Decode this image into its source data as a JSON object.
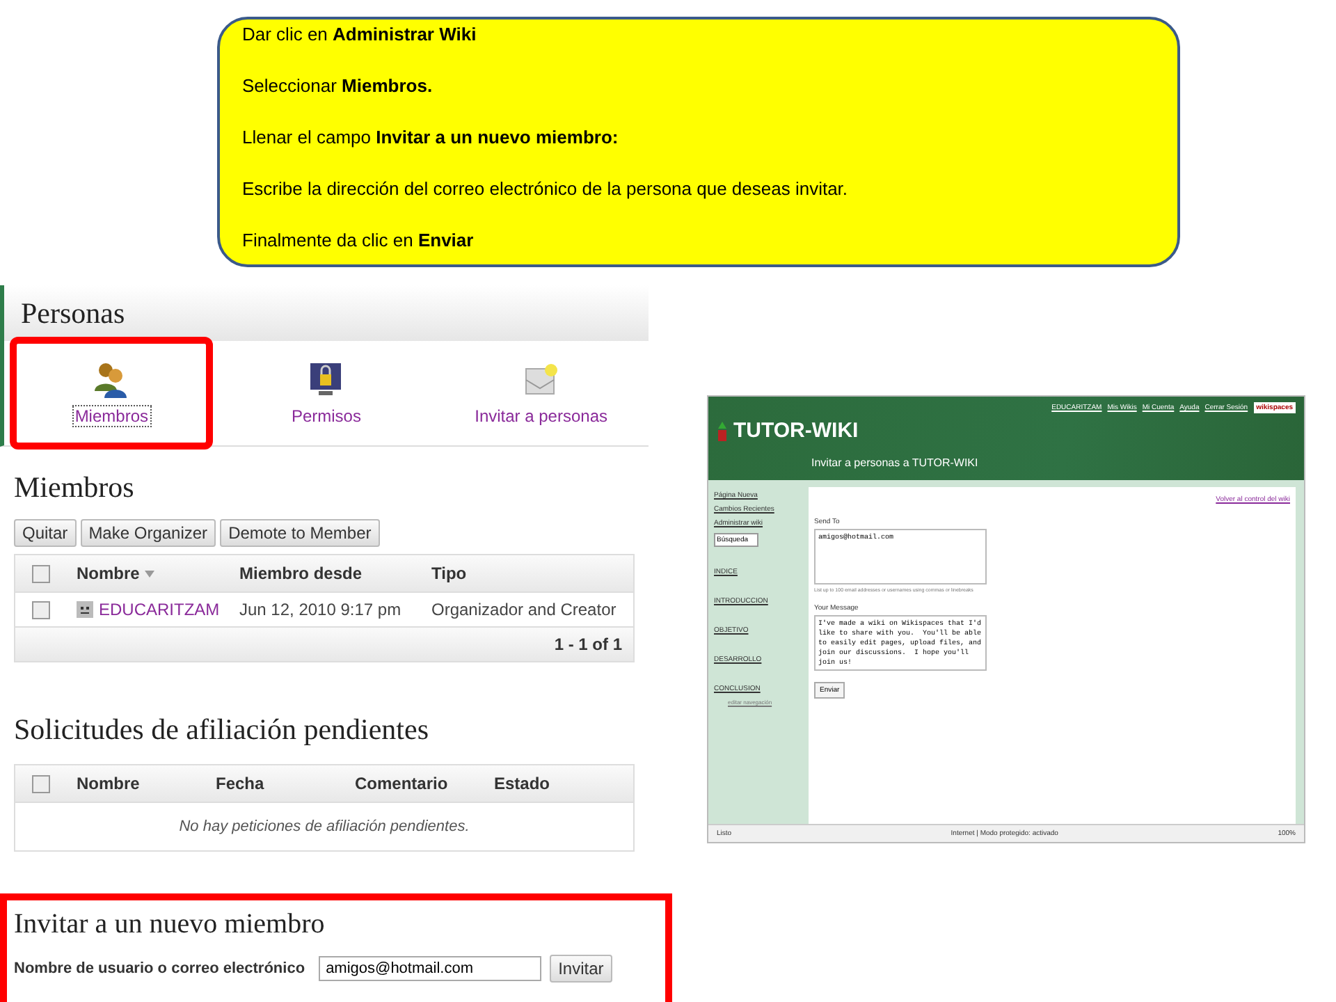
{
  "callout": {
    "lines": [
      "Dar clic en **Administrar Wiki**",
      "Seleccionar **Miembros.**",
      "Llenar el campo **Invitar a un nuevo miembro:**",
      "Escribe la dirección del correo electrónico de la persona que deseas invitar.",
      "Finalmente da clic en **Enviar**"
    ]
  },
  "personas": {
    "title": "Personas",
    "items": [
      {
        "label": "Miembros",
        "kind": "people",
        "selected": true
      },
      {
        "label": "Permisos",
        "kind": "lock",
        "selected": false
      },
      {
        "label": "Invitar a personas",
        "kind": "envelope",
        "selected": false
      }
    ]
  },
  "miembros": {
    "title": "Miembros",
    "buttons": [
      "Quitar",
      "Make Organizer",
      "Demote to Member"
    ],
    "select_all_checked": false,
    "columns": [
      "Nombre",
      "Miembro desde",
      "Tipo"
    ],
    "rows": [
      {
        "name": "EDUCARITZAM",
        "since": "Jun 12, 2010 9:17 pm",
        "type": "Organizador and Creator",
        "checked": false
      }
    ],
    "pager": "1 - 1 of 1"
  },
  "solicitudes": {
    "title": "Solicitudes de afiliación pendientes",
    "columns": [
      "Nombre",
      "Fecha",
      "Comentario",
      "Estado"
    ],
    "select_all_checked": false,
    "empty": "No hay peticiones de afiliación pendientes."
  },
  "invitar": {
    "title": "Invitar a un nuevo miembro",
    "label": "Nombre de usuario o correo electrónico",
    "value": "amigos@hotmail.com",
    "button": "Invitar"
  },
  "browser": {
    "logo": "TUTOR-WIKI",
    "top_links": [
      "EDUCARITZAM",
      "Mis Wikis",
      "Mi Cuenta",
      "Ayuda",
      "Cerrar Sesión"
    ],
    "brand": "wikispaces",
    "page_title": "Invitar a personas a TUTOR-WIKI",
    "side_actions": [
      "Página Nueva",
      "Cambios Recientes",
      "Administrar wiki"
    ],
    "search": "Búsqueda",
    "nav": [
      "INDICE",
      "INTRODUCCION",
      "OBJETIVO",
      "DESARROLLO",
      "CONCLUSION"
    ],
    "edit_nav": "editar navegación",
    "back_link": "Volver al control del wiki",
    "send_label": "Send To",
    "send_value": "amigos@hotmail.com",
    "hint": "List up to 100 email addresses or usernames using commas or linebreaks",
    "message_label": "Your Message",
    "message": "I've made a wiki on Wikispaces that I'd like to share with you.  You'll be able to easily edit pages, upload files, and join our discussions.  I hope you'll join us!",
    "send_button": "Enviar",
    "status": "Listo",
    "zone": "Internet | Modo protegido: activado",
    "zoom": "100%"
  }
}
